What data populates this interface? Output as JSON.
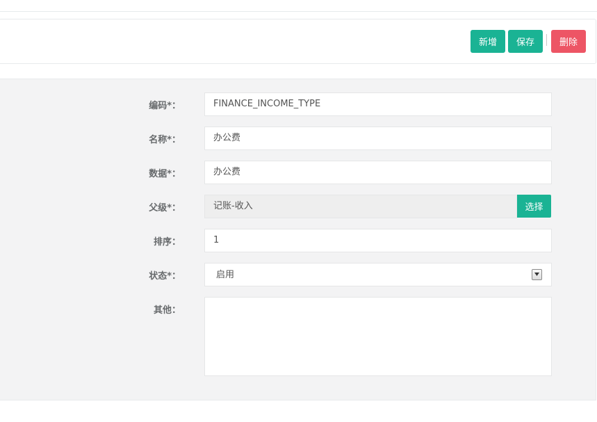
{
  "toolbar": {
    "add_label": "新增",
    "save_label": "保存",
    "delete_label": "删除",
    "add_color": "#1ab394",
    "save_color": "#1ab394",
    "delete_color": "#ed5565"
  },
  "form": {
    "code": {
      "label": "编码*：",
      "value": "FINANCE_INCOME_TYPE"
    },
    "name": {
      "label": "名称*：",
      "value": "办公费"
    },
    "data": {
      "label": "数据*：",
      "value": "办公费"
    },
    "parent": {
      "label": "父级*：",
      "value": "记账-收入",
      "pick_label": "选择"
    },
    "sort": {
      "label": "排序：",
      "value": "1"
    },
    "status": {
      "label": "状态*：",
      "value": "启用"
    },
    "other": {
      "label": "其他：",
      "value": ""
    }
  },
  "icons": {
    "select_arrow": "chevron-down-icon",
    "resize_grip": "resize-grip-icon"
  }
}
